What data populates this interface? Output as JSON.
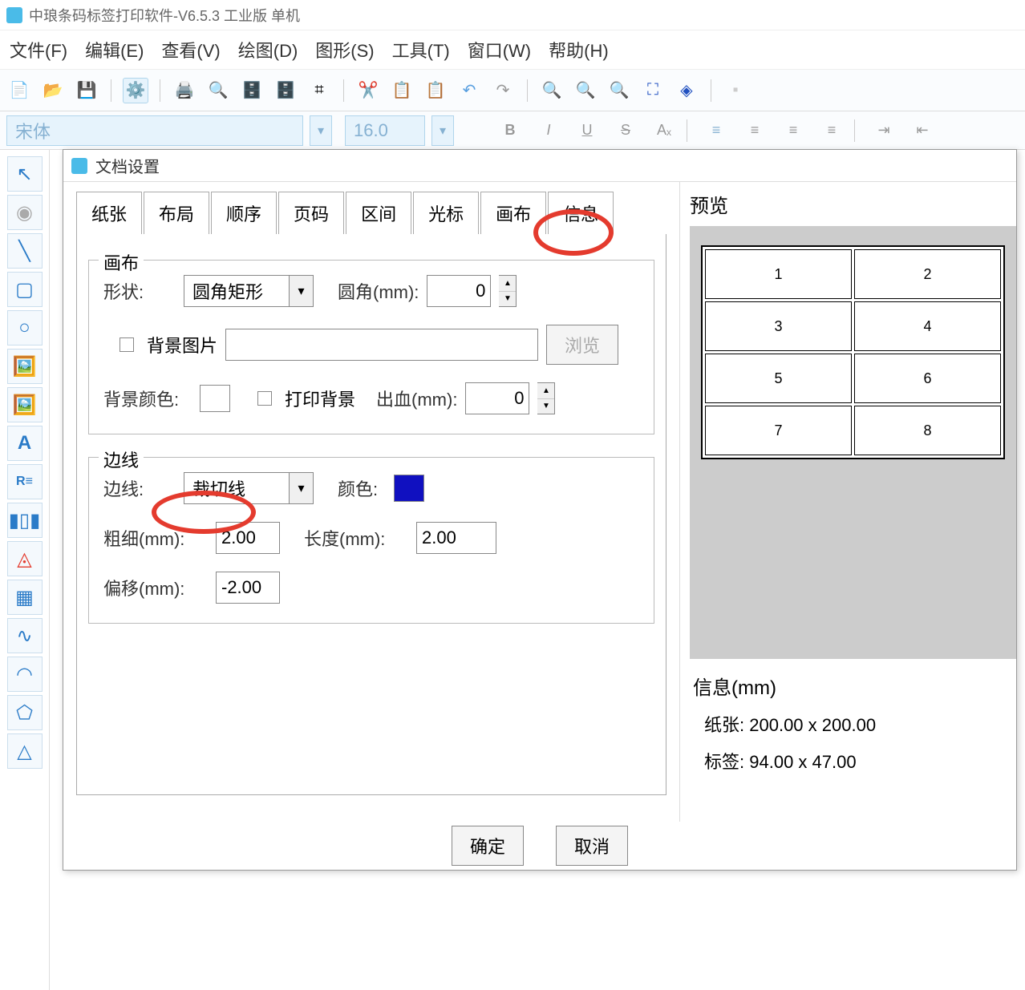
{
  "app": {
    "title": "中琅条码标签打印软件-V6.5.3 工业版 单机"
  },
  "menu": {
    "file": "文件(F)",
    "edit": "编辑(E)",
    "view": "查看(V)",
    "draw": "绘图(D)",
    "shape": "图形(S)",
    "tool": "工具(T)",
    "window": "窗口(W)",
    "help": "帮助(H)"
  },
  "font": {
    "name": "宋体",
    "size": "16.0"
  },
  "dialog": {
    "title": "文档设置",
    "tabs": {
      "paper": "纸张",
      "layout": "布局",
      "order": "顺序",
      "page": "页码",
      "range": "区间",
      "cursor": "光标",
      "canvas": "画布",
      "info": "信息"
    },
    "canvas_group": {
      "legend": "画布",
      "shape_lbl": "形状:",
      "shape_val": "圆角矩形",
      "corner_lbl": "圆角(mm):",
      "corner_val": "0",
      "bgimg_lbl": "背景图片",
      "bgimg_val": "",
      "browse": "浏览",
      "bgcolor_lbl": "背景颜色:",
      "printbg_lbl": "打印背景",
      "bleed_lbl": "出血(mm):",
      "bleed_val": "0"
    },
    "border_group": {
      "legend": "边线",
      "border_lbl": "边线:",
      "border_val": "裁切线",
      "color_lbl": "颜色:",
      "color_val": "#1010c0",
      "thick_lbl": "粗细(mm):",
      "thick_val": "2.00",
      "length_lbl": "长度(mm):",
      "length_val": "2.00",
      "offset_lbl": "偏移(mm):",
      "offset_val": "-2.00"
    },
    "preview_lbl": "预览",
    "preview_cells": [
      "1",
      "2",
      "3",
      "4",
      "5",
      "6",
      "7",
      "8"
    ],
    "info_lbl": "信息(mm)",
    "paper_lbl": "纸张:",
    "paper_val": "200.00 x 200.00",
    "label_lbl": "标签:",
    "label_val": "94.00 x 47.00",
    "ok": "确定",
    "cancel": "取消"
  }
}
